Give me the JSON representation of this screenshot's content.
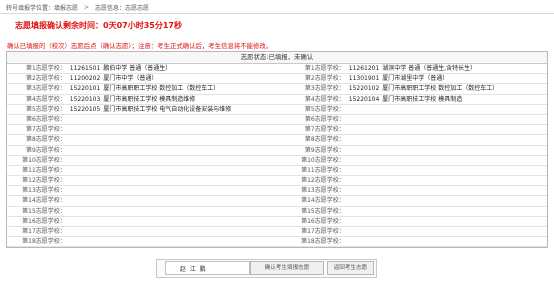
{
  "breadcrumb": [
    "转号填报学位置：填报志愿",
    "志愿信息：志愿志愿"
  ],
  "countdown": "志愿填报确认剩余时间：0天07小时35分17秒",
  "notice": "确认已填报的（校次）志愿后点（确认志愿）；注意：考生正式确认后，考生信息将不能修改。",
  "status": "志愿状态:已填报，未确认",
  "rows": [
    {
      "left_label": "第1志愿学校：",
      "left_code": "11261501",
      "left_name": "鹏伯中学 普通（普通生）",
      "right_label": "第1志愿学校：",
      "right_code": "11261201",
      "right_name": "湖滨中学 普通（普通生,含特长生）"
    },
    {
      "left_label": "第2志愿学校：",
      "left_code": "11200202",
      "left_name": "厦门市中学（普通）",
      "right_label": "第2志愿学校：",
      "right_code": "11301901",
      "right_name": "厦门市湖里中学（普通）"
    },
    {
      "left_label": "第3志愿学校：",
      "left_code": "15220101",
      "left_name": "厦门市高职职工学校 数控加工（数控车工）",
      "right_label": "第3志愿学校：",
      "right_code": "15220102",
      "right_name": "厦门市高职职工学校 数控加工（数控车工）"
    },
    {
      "left_label": "第4志愿学校：",
      "left_code": "15220103",
      "left_name": "厦门市高职技工学校 模具制造维修",
      "right_label": "第4志愿学校：",
      "right_code": "15220104",
      "right_name": "厦门市高职技工学校 模具制造"
    },
    {
      "left_label": "第5志愿学校：",
      "left_code": "15220105",
      "left_name": "厦门市高职技工学校 电气自动化设备安装与维修",
      "right_label": "第5志愿学校：",
      "right_code": "",
      "right_name": ""
    },
    {
      "left_label": "第6志愿学校：",
      "left_code": "",
      "left_name": "",
      "right_label": "第6志愿学校：",
      "right_code": "",
      "right_name": ""
    },
    {
      "left_label": "第7志愿学校：",
      "left_code": "",
      "left_name": "",
      "right_label": "第7志愿学校：",
      "right_code": "",
      "right_name": ""
    },
    {
      "left_label": "第8志愿学校：",
      "left_code": "",
      "left_name": "",
      "right_label": "第8志愿学校：",
      "right_code": "",
      "right_name": ""
    },
    {
      "left_label": "第9志愿学校：",
      "left_code": "",
      "left_name": "",
      "right_label": "第9志愿学校：",
      "right_code": "",
      "right_name": ""
    },
    {
      "left_label": "第10志愿学校：",
      "left_code": "",
      "left_name": "",
      "right_label": "第10志愿学校：",
      "right_code": "",
      "right_name": ""
    },
    {
      "left_label": "第11志愿学校：",
      "left_code": "",
      "left_name": "",
      "right_label": "第11志愿学校：",
      "right_code": "",
      "right_name": ""
    },
    {
      "left_label": "第12志愿学校：",
      "left_code": "",
      "left_name": "",
      "right_label": "第12志愿学校：",
      "right_code": "",
      "right_name": ""
    },
    {
      "left_label": "第13志愿学校：",
      "left_code": "",
      "left_name": "",
      "right_label": "第13志愿学校：",
      "right_code": "",
      "right_name": ""
    },
    {
      "left_label": "第14志愿学校：",
      "left_code": "",
      "left_name": "",
      "right_label": "第14志愿学校：",
      "right_code": "",
      "right_name": ""
    },
    {
      "left_label": "第15志愿学校：",
      "left_code": "",
      "left_name": "",
      "right_label": "第15志愿学校：",
      "right_code": "",
      "right_name": ""
    },
    {
      "left_label": "第16志愿学校：",
      "left_code": "",
      "left_name": "",
      "right_label": "第16志愿学校：",
      "right_code": "",
      "right_name": ""
    },
    {
      "left_label": "第17志愿学校：",
      "left_code": "",
      "left_name": "",
      "right_label": "第17志愿学校：",
      "right_code": "",
      "right_name": ""
    },
    {
      "left_label": "第18志愿学校：",
      "left_code": "",
      "left_name": "",
      "right_label": "第18志愿学校：",
      "right_code": "",
      "right_name": ""
    }
  ],
  "footer": {
    "name_value": "赵  江  鹏",
    "confirm_label": "确认考生填报志愿",
    "return_label": "返回考生志愿"
  },
  "colors": {
    "alert": "#e01010",
    "border": "#b8b8b8"
  }
}
